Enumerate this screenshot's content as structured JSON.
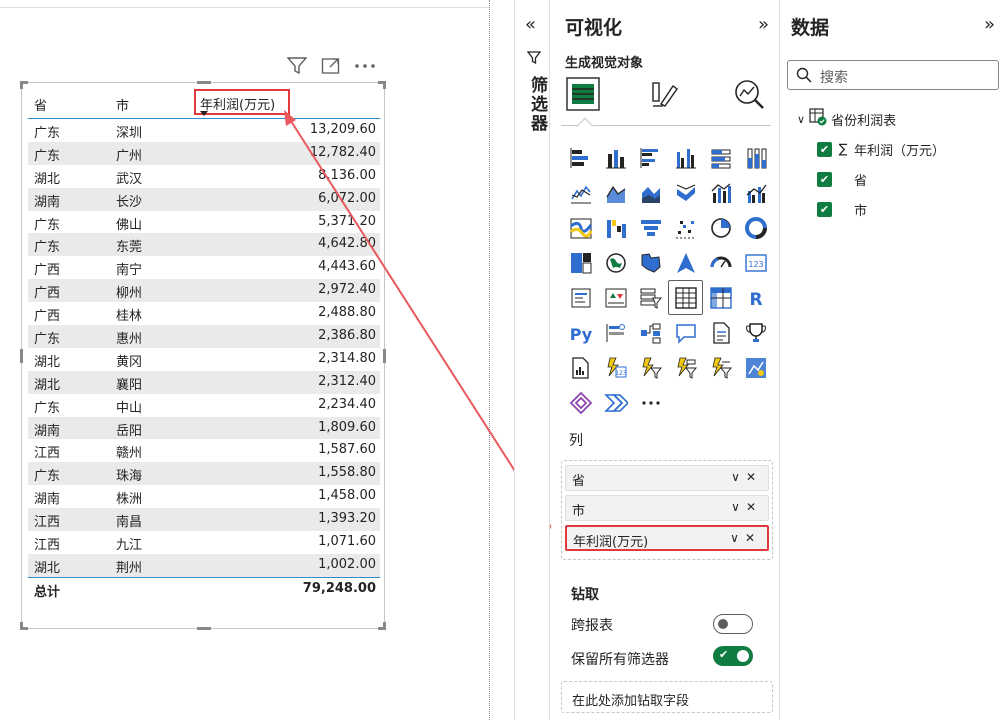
{
  "visual_header": {
    "icons": [
      "filter-icon",
      "focus-mode-icon",
      "more-options-icon"
    ]
  },
  "table": {
    "headers": {
      "province": "省",
      "city": "市",
      "profit": "年利润(万元)"
    },
    "rows": [
      {
        "province": "广东",
        "city": "深圳",
        "value": "13,209.60"
      },
      {
        "province": "广东",
        "city": "广州",
        "value": "12,782.40"
      },
      {
        "province": "湖北",
        "city": "武汉",
        "value": "8,136.00"
      },
      {
        "province": "湖南",
        "city": "长沙",
        "value": "6,072.00"
      },
      {
        "province": "广东",
        "city": "佛山",
        "value": "5,371.20"
      },
      {
        "province": "广东",
        "city": "东莞",
        "value": "4,642.80"
      },
      {
        "province": "广西",
        "city": "南宁",
        "value": "4,443.60"
      },
      {
        "province": "广西",
        "city": "柳州",
        "value": "2,972.40"
      },
      {
        "province": "广西",
        "city": "桂林",
        "value": "2,488.80"
      },
      {
        "province": "广东",
        "city": "惠州",
        "value": "2,386.80"
      },
      {
        "province": "湖北",
        "city": "黄冈",
        "value": "2,314.80"
      },
      {
        "province": "湖北",
        "city": "襄阳",
        "value": "2,312.40"
      },
      {
        "province": "广东",
        "city": "中山",
        "value": "2,234.40"
      },
      {
        "province": "湖南",
        "city": "岳阳",
        "value": "1,809.60"
      },
      {
        "province": "江西",
        "city": "赣州",
        "value": "1,587.60"
      },
      {
        "province": "广东",
        "city": "珠海",
        "value": "1,558.80"
      },
      {
        "province": "湖南",
        "city": "株洲",
        "value": "1,458.00"
      },
      {
        "province": "江西",
        "city": "南昌",
        "value": "1,393.20"
      },
      {
        "province": "江西",
        "city": "九江",
        "value": "1,071.60"
      },
      {
        "province": "湖北",
        "city": "荆州",
        "value": "1,002.00"
      }
    ],
    "total_label": "总计",
    "total_value": "79,248.00"
  },
  "filters": {
    "label": "筛选器",
    "collapse": "«"
  },
  "visualizations": {
    "title": "可视化",
    "expand": "»",
    "subtitle": "生成视觉对象",
    "more": "···",
    "columns_title": "列",
    "column_fields": [
      "省",
      "市",
      "年利润(万元)"
    ],
    "drill_title": "钻取",
    "cross_report_label": "跨报表",
    "cross_report_on": false,
    "keep_filters_label": "保留所有筛选器",
    "keep_filters_on": true,
    "drill_add_placeholder": "在此处添加钻取字段"
  },
  "data_pane": {
    "title": "数据",
    "expand": "»",
    "search_placeholder": "搜索",
    "table_name": "省份利润表",
    "fields": [
      {
        "label": "年利润（万元）",
        "sigma": true,
        "checked": true
      },
      {
        "label": "省",
        "sigma": false,
        "checked": true
      },
      {
        "label": "市",
        "sigma": false,
        "checked": true
      }
    ]
  },
  "colors": {
    "highlight": "#e0393e",
    "arrow": "#e85a5d",
    "accent_green": "#107c41",
    "header_line": "#2f8ec9",
    "alt_row": "#eaeaea"
  }
}
